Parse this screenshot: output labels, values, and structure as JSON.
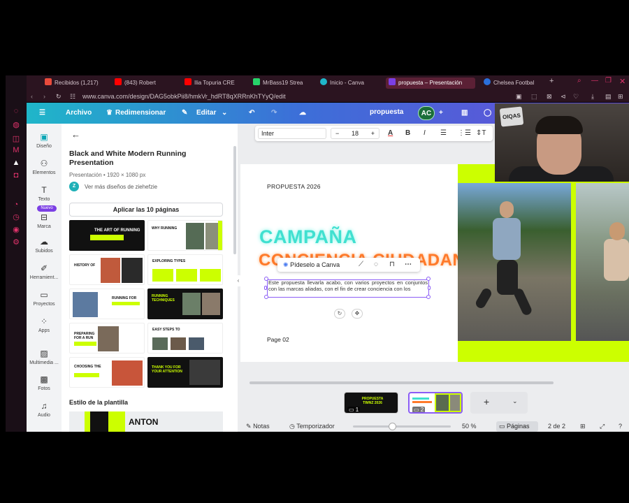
{
  "browser": {
    "tabs": [
      {
        "label": "Recibidos (1,217)",
        "icon_color": "#e94b3c"
      },
      {
        "label": "(843) Robert",
        "icon_color": "#ff0000"
      },
      {
        "label": "Ilia Topuria CRE",
        "icon_color": "#ff0000"
      },
      {
        "label": "MrBass19 Strea",
        "icon_color": "#27d36a"
      },
      {
        "label": "Inicio - Canva",
        "icon_color": "#1fb6c9"
      },
      {
        "label": "propuesta – Presentación",
        "icon_color": "#7b3fe4"
      },
      {
        "label": "Chelsea Footbal",
        "icon_color": "#2a6fdb"
      }
    ],
    "url": "www.canva.com/design/DAG5obkPii8/hmkVr_hdRT8qXRRnKhTYyQ/edit"
  },
  "header": {
    "menu_label": "Archivo",
    "resize_label": "Redimensionar",
    "edit_label": "Editar",
    "doc_title": "propuesta",
    "avatar_initials": "AC"
  },
  "rail": {
    "items": [
      {
        "label": "Diseño"
      },
      {
        "label": "Elementos"
      },
      {
        "label": "Texto"
      },
      {
        "label": "Marca"
      },
      {
        "label": "Subidos"
      },
      {
        "label": "Herramient..."
      },
      {
        "label": "Proyectos"
      },
      {
        "label": "Apps"
      },
      {
        "label": "Multimedia ..."
      },
      {
        "label": "Fotos"
      },
      {
        "label": "Audio"
      }
    ],
    "new_badge": "Nuevo"
  },
  "panel": {
    "title": "Black and White Modern Running Presentation",
    "meta": "Presentación • 1920 × 1080 px",
    "author_initial": "Z",
    "author_link": "Ver más diseños de ziehefzie",
    "apply_label": "Aplicar las 10 páginas",
    "thumbs": [
      {
        "text": "THE ART OF RUNNING"
      },
      {
        "text": "WHY RUNNING"
      },
      {
        "text": "HISTORY OF"
      },
      {
        "text": "EXPLORING TYPES"
      },
      {
        "text": "RUNNING FOR"
      },
      {
        "text": "RUNNING TECHNIQUES"
      },
      {
        "text": "PREPARING FOR A RUN"
      },
      {
        "text": "EASY STEPS TO"
      },
      {
        "text": "CHOOSING THE"
      },
      {
        "text": "THANK YOU FOR YOUR ATTENTION"
      }
    ],
    "style_title": "Estilo de la plantilla",
    "style_font": "ANTON"
  },
  "toolbar": {
    "font": "Inter",
    "size": "18"
  },
  "slide": {
    "kicker": "PROPUESTA 2026",
    "headline1": "CAMPAÑA",
    "headline2": "CONCIENCIA CIUDADANA",
    "body": "Este propuesta llevarla acabo, con varios proyectos en conjuntos con las marcas aliadas, con el fin de crear conciencia con los",
    "page_label": "Page 02"
  },
  "float_menu": {
    "ask_label": "Pídeselo a Canva"
  },
  "pages": {
    "thumb1_number": "1",
    "thumb1_text": "PROPUESTA TIMNZ 2026",
    "thumb2_number": "2"
  },
  "footer": {
    "notes": "Notas",
    "timer": "Temporizador",
    "zoom": "50 %",
    "pages": "Páginas",
    "page_count": "2 de 2"
  },
  "webcam": {
    "sign_text": "OIQAS"
  },
  "colors": {
    "accent_lime": "#ccff00",
    "canva_teal": "#1fb6c9",
    "canva_purple": "#6a4cd9",
    "headline_cyan": "#40e0d0",
    "headline_orange": "#ff7a2a"
  }
}
